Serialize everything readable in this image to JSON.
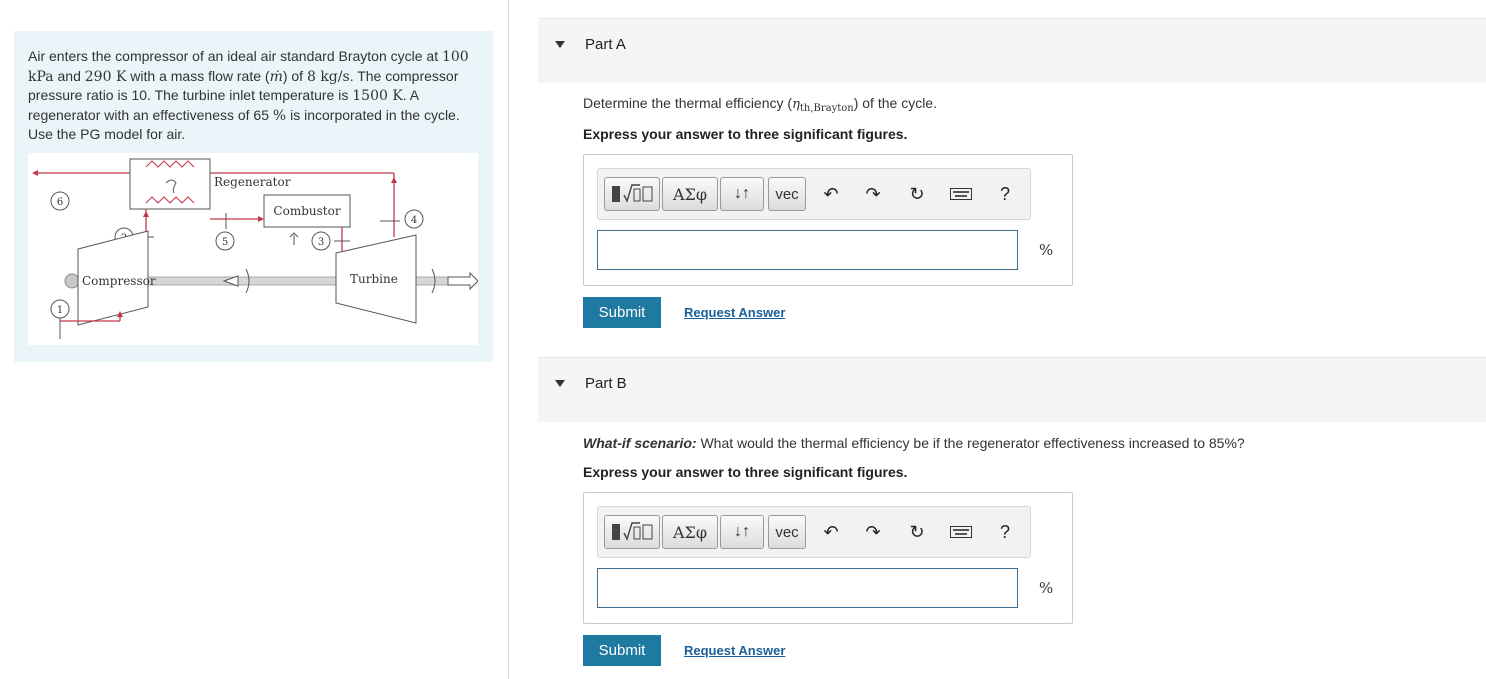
{
  "problem": {
    "text_parts": [
      "Air enters the compressor of an ideal air standard Brayton cycle at ",
      "100 kPa",
      " and ",
      "290 K",
      " with a mass flow rate (",
      "ṁ",
      ") of ",
      "8 kg/s",
      ". The compressor pressure ratio is 10. The turbine inlet temperature is ",
      "1500 K",
      ". A regenerator with an effectiveness of 65 ",
      "%",
      " is incorporated in the cycle. Use the PG model for air."
    ],
    "diagram": {
      "labels": {
        "regenerator": "Regenerator",
        "combustor": "Combustor",
        "compressor": "Compressor",
        "turbine": "Turbine"
      },
      "states": [
        "1",
        "2",
        "3",
        "4",
        "5",
        "6"
      ],
      "colors": {
        "flow": "#c0394b",
        "machine_line": "#555555",
        "shaft": "#bdbdbd"
      }
    }
  },
  "toolbar": {
    "templates_icon": "fraction-sqrt-icon",
    "greek_label": "ΑΣφ",
    "arrows_label": "↓↑",
    "vec_label": "vec",
    "undo_icon": "undo-icon",
    "redo_icon": "redo-icon",
    "reset_icon": "reset-icon",
    "keyboard_icon": "keyboard-icon",
    "help_label": "?"
  },
  "parts": [
    {
      "title": "Part A",
      "question_prefix": "Determine the thermal efficiency (",
      "question_var": "η",
      "question_sub": "th,Brayton",
      "question_suffix": ") of the cycle.",
      "instruction": "Express your answer to three significant figures.",
      "answer_value": "",
      "unit": "%",
      "submit_label": "Submit",
      "request_label": "Request Answer"
    },
    {
      "title": "Part B",
      "question_lead": "What-if scenario:",
      "question_text": " What would the thermal efficiency be if the regenerator effectiveness increased to 85%?",
      "instruction": "Express your answer to three significant figures.",
      "answer_value": "",
      "unit": "%",
      "submit_label": "Submit",
      "request_label": "Request Answer"
    }
  ],
  "colors": {
    "accent": "#1f7aa1",
    "link": "#1a5f9a",
    "panel": "#e9f5f8"
  }
}
